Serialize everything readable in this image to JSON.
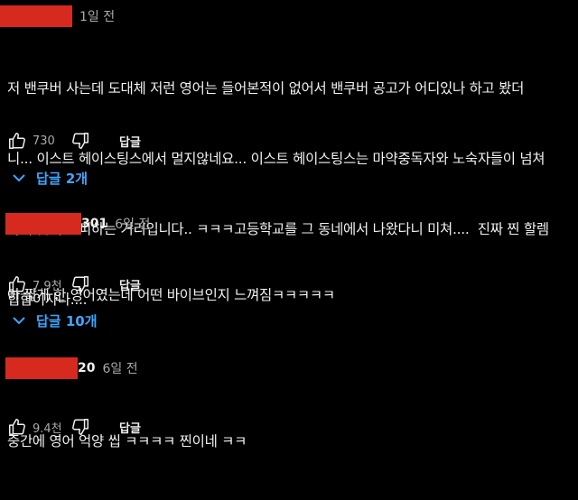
{
  "comments": [
    {
      "author_suffix": "",
      "time": "1일 전",
      "text_lines": [
        "저 밴쿠버 사는데 도대체 저런 영어는 들어본적이 없어서 밴쿠버 공고가 어디있나 하고 봤더",
        "니... 이스트 헤이스팅스에서 멀지않네요... 이스트 헤이스팅스는 마약중독자와 노숙자들이 넘쳐",
        "나서 낮에도 피하는 거리입니다.. ㅋㅋㅋ고등학교를 그 동네에서 나왔다니 미쳐....  진짜 찐 할렘",
        "힙합이자나...."
      ],
      "likes": "730",
      "reply_label": "답글",
      "replies_label": "답글 2개"
    },
    {
      "author_suffix": "301",
      "time": "6일 전",
      "text_lines": [
        "아 짧게 한 영어였는데 어떤 바이브인지 느껴짐ㅋㅋㅋㅋㅋ"
      ],
      "likes": "7.9천",
      "reply_label": "답글",
      "replies_label": "답글 10개"
    },
    {
      "author_suffix": "20",
      "time": "6일 전",
      "text_lines": [
        "중간에 영어 억양 씹 ㅋㅋㅋㅋ 찐이네 ㅋㅋ"
      ],
      "likes": "9.4천",
      "reply_label": "답글"
    }
  ],
  "colors": {
    "background": "#000000",
    "text": "#f1f1f1",
    "muted": "#aaaaaa",
    "link": "#3ea6ff",
    "redaction": "#d62a1e"
  },
  "icons": {
    "like": "thumbs-up-icon",
    "dislike": "thumbs-down-icon",
    "expand": "chevron-down-icon"
  }
}
